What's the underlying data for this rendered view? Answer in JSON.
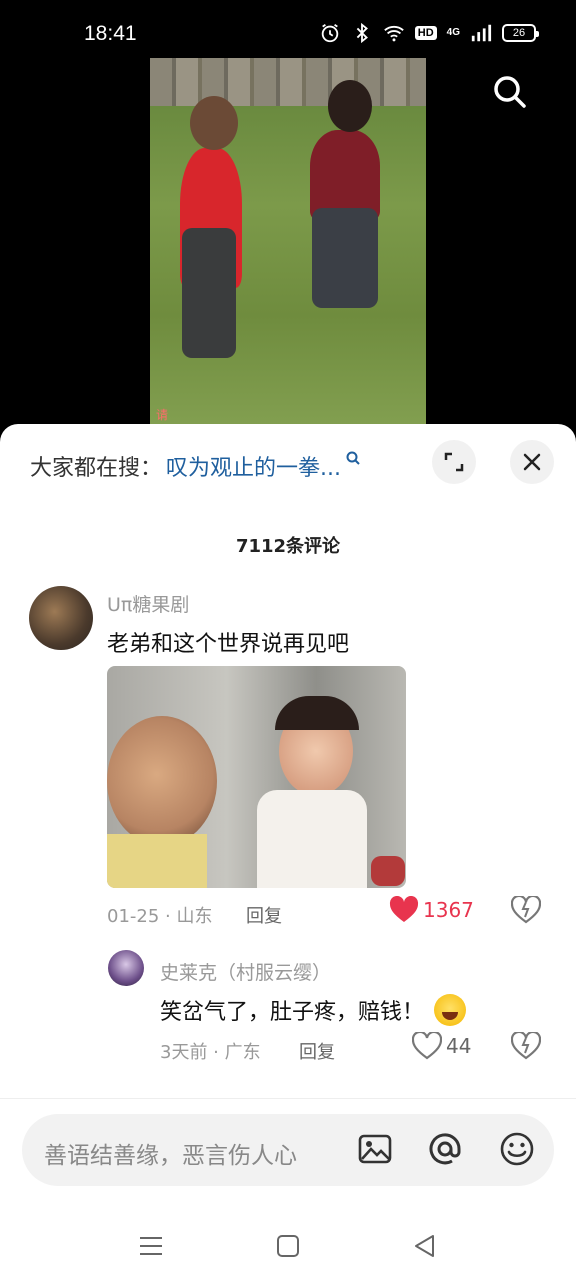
{
  "status": {
    "time": "18:41",
    "network": "4G",
    "hd": "HD",
    "battery": "26"
  },
  "video": {
    "caption": "请"
  },
  "search": {
    "prefix": "大家都在搜：",
    "keyword": "叹为观止的一拳..."
  },
  "comments_count": "7112条评论",
  "comment": {
    "user": "Uπ糖果剧",
    "text": "老弟和这个世界说再见吧",
    "date_loc": "01-25 · 山东",
    "reply_label": "回复",
    "likes": "1367"
  },
  "reply": {
    "user": "史莱克（村服云缨）",
    "text": "笑岔气了，肚子疼，赔钱！",
    "date_loc": "3天前 · 广东",
    "reply_label": "回复",
    "likes": "44"
  },
  "input": {
    "placeholder": "善语结善缘，恶言伤人心"
  },
  "colors": {
    "like_active": "#e8344e",
    "search_keyword": "#1f5f9e"
  },
  "icons": [
    "alarm-icon",
    "bluetooth-icon",
    "wifi-icon",
    "signal-icon",
    "battery-icon",
    "search-icon",
    "expand-icon",
    "close-icon",
    "heart-icon",
    "dislike-icon",
    "image-icon",
    "at-icon",
    "emoji-icon",
    "menu-icon",
    "home-icon",
    "back-icon"
  ]
}
